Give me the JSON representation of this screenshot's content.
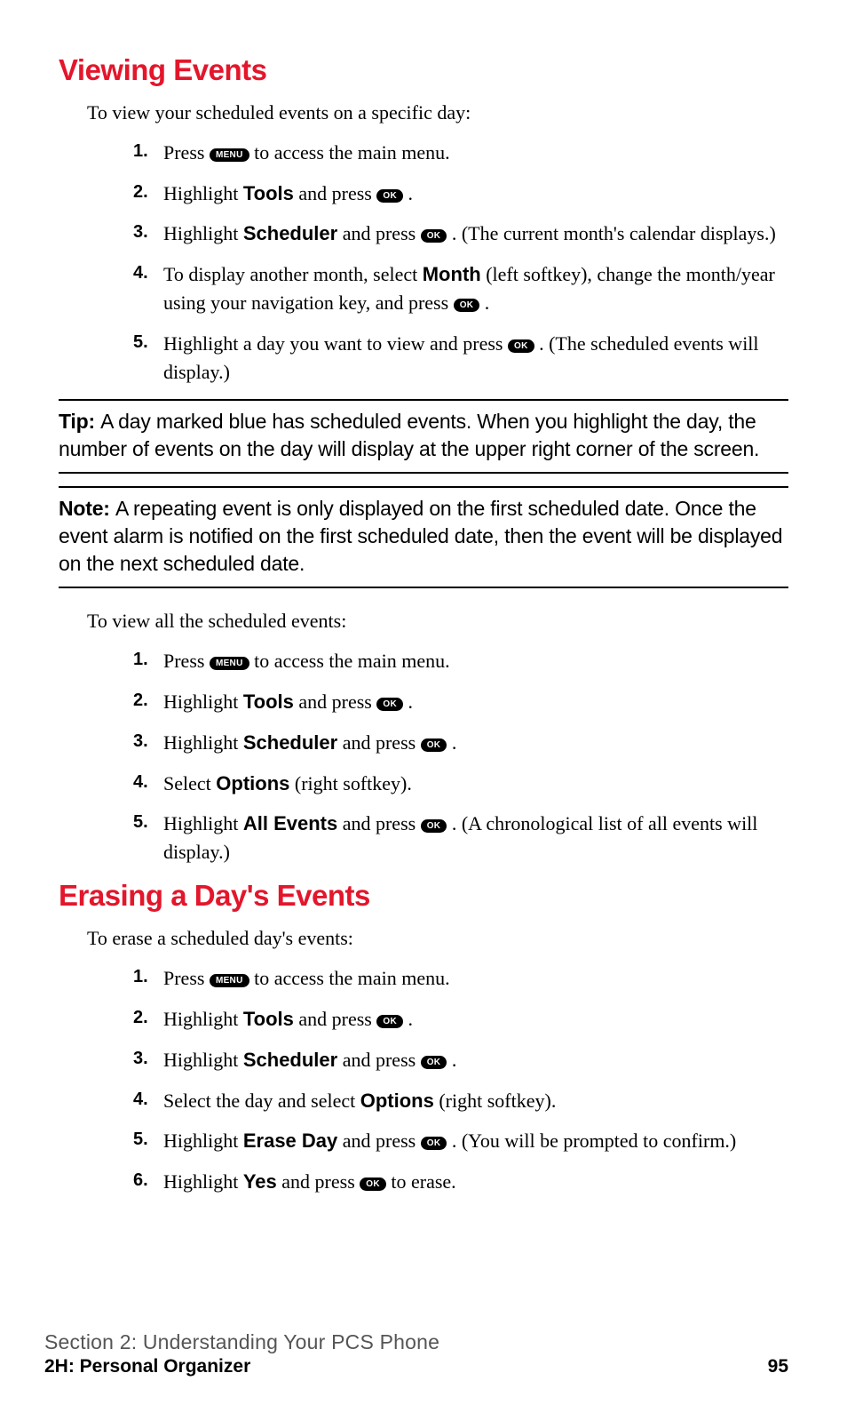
{
  "key": {
    "menu": "MENU",
    "ok": "OK"
  },
  "sec1": {
    "heading": "Viewing Events",
    "intro": "To view your scheduled events on a specific day:",
    "s1a": "Press ",
    "s1b": " to access the main menu.",
    "s2a": "Highlight ",
    "s2b": "Tools",
    "s2c": " and press ",
    "s2d": ".",
    "s3a": "Highlight ",
    "s3b": "Scheduler",
    "s3c": " and press ",
    "s3d": ". (The current month's calendar displays.)",
    "s4a": "To display another month, select ",
    "s4b": "Month",
    "s4c": " (left softkey), change the month/year using your navigation key, and press ",
    "s4d": ".",
    "s5a": "Highlight a day you want to view and press ",
    "s5b": ". (The scheduled events will display.)"
  },
  "tip": {
    "label": "Tip: ",
    "text": "A day marked blue has scheduled events. When you highlight the day, the number of events on the day will display at the upper right corner of the screen."
  },
  "note": {
    "label": "Note:  ",
    "text": "A repeating event is only displayed on the first scheduled date. Once the event alarm is notified on the first scheduled date, then the event will be displayed on the next scheduled date."
  },
  "sec2": {
    "intro": "To view all the scheduled events:",
    "s1a": "Press ",
    "s1b": " to access the main menu.",
    "s2a": "Highlight ",
    "s2b": "Tools",
    "s2c": " and press ",
    "s2d": ".",
    "s3a": "Highlight ",
    "s3b": "Scheduler",
    "s3c": " and press ",
    "s3d": ".",
    "s4a": "Select ",
    "s4b": "Options",
    "s4c": " (right softkey).",
    "s5a": "Highlight ",
    "s5b": "All Events",
    "s5c": " and press ",
    "s5d": ". (A chronological list of all events will display.)"
  },
  "sec3": {
    "heading": "Erasing a Day's Events",
    "intro": "To erase a scheduled day's events:",
    "s1a": "Press ",
    "s1b": " to access the main menu.",
    "s2a": "Highlight ",
    "s2b": "Tools",
    "s2c": " and press ",
    "s2d": ".",
    "s3a": "Highlight ",
    "s3b": "Scheduler",
    "s3c": " and press ",
    "s3d": ".",
    "s4a": "Select the day and select ",
    "s4b": "Options",
    "s4c": " (right softkey).",
    "s5a": "Highlight ",
    "s5b": "Erase Day",
    "s5c": " and press ",
    "s5d": ". (You will be prompted to confirm.)",
    "s6a": "Highlight ",
    "s6b": "Yes",
    "s6c": " and press ",
    "s6d": " to erase."
  },
  "nums": {
    "n1": "1.",
    "n2": "2.",
    "n3": "3.",
    "n4": "4.",
    "n5": "5.",
    "n6": "6."
  },
  "footer": {
    "section": "Section 2: Understanding Your PCS Phone",
    "sub": "2H: Personal Organizer",
    "page": "95"
  }
}
